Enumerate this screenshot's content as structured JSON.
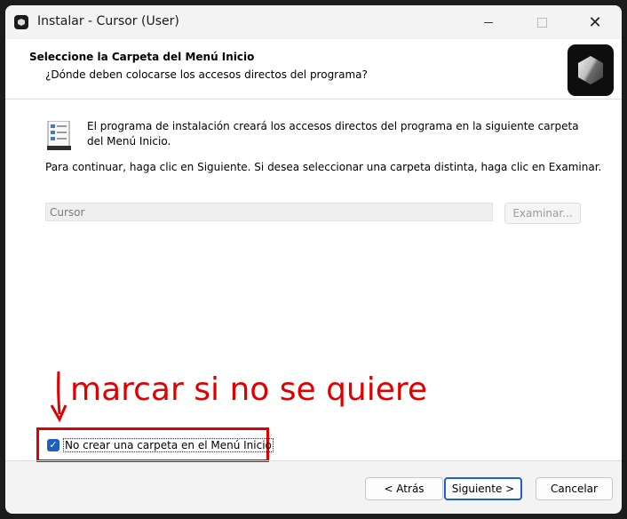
{
  "window": {
    "title": "Instalar - Cursor (User)"
  },
  "header": {
    "title": "Seleccione la Carpeta del Menú Inicio",
    "subtitle": "¿Dónde deben colocarse los accesos directos del programa?"
  },
  "body": {
    "info_text": "El programa de instalación creará los accesos directos del programa en la siguiente carpeta del Menú Inicio.",
    "instruction_text": "Para continuar, haga clic en Siguiente. Si desea seleccionar una carpeta distinta, haga clic en Examinar.",
    "folder_value": "Cursor",
    "browse_label": "Examinar..."
  },
  "annotation": {
    "text": "marcar si no se quiere"
  },
  "checkbox": {
    "label": "No crear una carpeta en el Menú Inicio",
    "checked": true
  },
  "footer": {
    "back_label": "< Atrás",
    "next_label": "Siguiente >",
    "cancel_label": "Cancelar"
  },
  "colors": {
    "annotation": "#e00000",
    "accent": "#1b64c4"
  }
}
